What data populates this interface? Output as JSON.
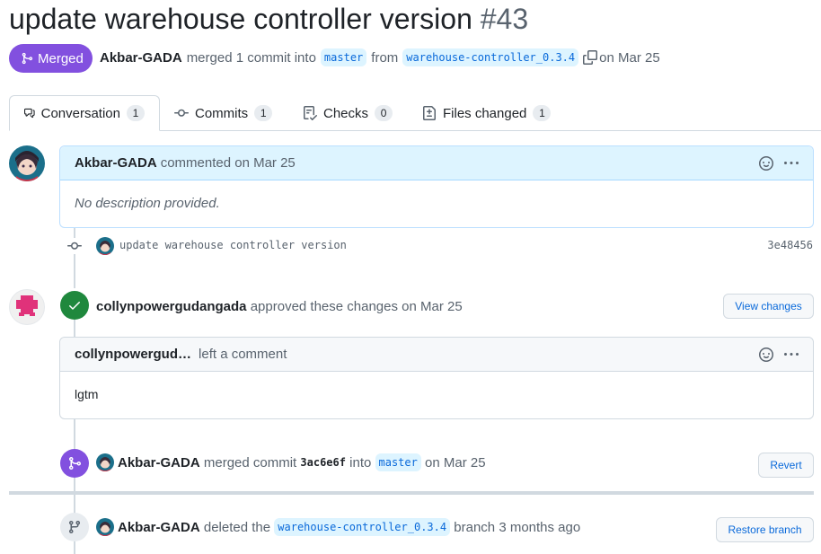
{
  "pr": {
    "title": "update warehouse controller version",
    "number": "#43",
    "state_label": "Merged",
    "author": "Akbar-GADA",
    "summary_merged": "merged 1 commit into",
    "base_branch": "master",
    "from_word": "from",
    "head_branch": "warehouse-controller_0.3.4",
    "date_text": "on Mar 25"
  },
  "tabs": [
    {
      "label": "Conversation",
      "count": "1",
      "icon": "comment-discussion-icon"
    },
    {
      "label": "Commits",
      "count": "1",
      "icon": "git-commit-icon"
    },
    {
      "label": "Checks",
      "count": "0",
      "icon": "checklist-icon"
    },
    {
      "label": "Files changed",
      "count": "1",
      "icon": "file-diff-icon"
    }
  ],
  "first_comment": {
    "author": "Akbar-GADA",
    "action": "commented on Mar 25",
    "body": "No description provided."
  },
  "commit": {
    "message": "update warehouse controller version",
    "sha": "3e48456"
  },
  "review": {
    "reviewer": "collynpowergudangada",
    "action": "approved these changes on Mar 25",
    "button": "View changes",
    "comment_author": "collynpowergud…",
    "comment_action": "left a comment",
    "comment_body": "lgtm"
  },
  "merge_event": {
    "author": "Akbar-GADA",
    "action": "merged commit",
    "sha": "3ac6e6f",
    "into": "into",
    "branch": "master",
    "date": "on Mar 25",
    "button": "Revert"
  },
  "delete_event": {
    "author": "Akbar-GADA",
    "action": "deleted the",
    "branch": "warehouse-controller_0.3.4",
    "suffix": "branch 3 months ago",
    "button": "Restore branch"
  },
  "colors": {
    "merged_purple": "#8250df",
    "approved_green": "#1f883d",
    "link_blue": "#0969da",
    "header_blue_bg": "#ddf4ff"
  }
}
